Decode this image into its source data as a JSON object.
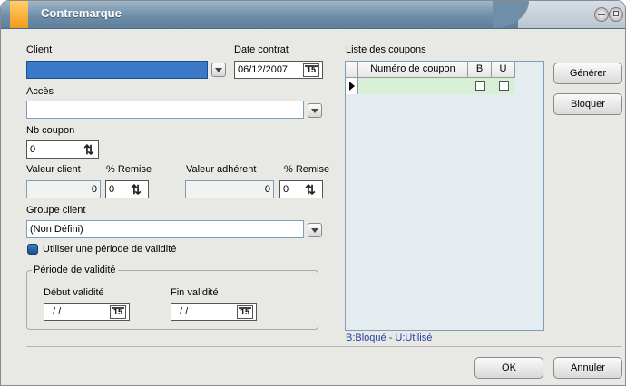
{
  "window": {
    "title": "Contremarque"
  },
  "form": {
    "client_label": "Client",
    "client_value": "",
    "date_contrat_label": "Date contrat",
    "date_contrat_value": "06/12/2007",
    "acces_label": "Accès",
    "acces_value": "",
    "nb_coupon_label": "Nb coupon",
    "nb_coupon_value": "0",
    "valeur_client_label": "Valeur client",
    "valeur_client_value": "0",
    "remise1_label": "% Remise",
    "remise1_value": "0",
    "valeur_adherent_label": "Valeur adhérent",
    "valeur_adherent_value": "0",
    "remise2_label": "% Remise",
    "remise2_value": "0",
    "groupe_client_label": "Groupe client",
    "groupe_client_value": "(Non Défini)",
    "validite_checkbox_label": "Utiliser une période de validité",
    "periode_group_title": "Période de validité",
    "debut_label": "Début validité",
    "debut_value": "/ /",
    "fin_label": "Fin validité",
    "fin_value": "/ /",
    "calendar_glyph": "15"
  },
  "coupons": {
    "label": "Liste des coupons",
    "columns": [
      "Numéro de coupon",
      "B",
      "U"
    ],
    "rows": [
      {
        "numero": "",
        "b": false,
        "u": false
      }
    ],
    "legend": "B:Bloqué - U:Utilisé"
  },
  "buttons": {
    "generer": "Générer",
    "bloquer": "Bloquer",
    "ok": "OK",
    "annuler": "Annuler"
  },
  "colors": {
    "titlebar": "#6f8ea8",
    "accent": "#f29b1e",
    "grid_row": "#d6efd6",
    "legend": "#1f3ea8"
  }
}
